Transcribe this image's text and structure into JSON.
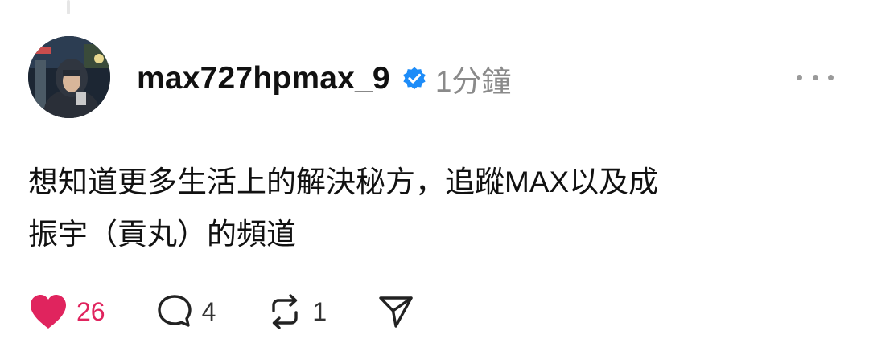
{
  "post": {
    "username": "max727hpmax_9",
    "timestamp": "1分鐘",
    "body_lines": [
      "想知道更多生活上的解決秘方，追蹤MAX以及成",
      "振宇（貢丸）的頻道"
    ]
  },
  "actions": {
    "likes": "26",
    "comments": "4",
    "reposts": "1"
  },
  "icons": {
    "verified": "verified-badge-icon",
    "more": "more-options-icon",
    "like": "heart-icon",
    "comment": "comment-bubble-icon",
    "repost": "repost-icon",
    "share": "send-icon"
  },
  "colors": {
    "like_active": "#e0245e",
    "verified": "#1d8cf8",
    "timestamp": "#8a8a8a"
  }
}
